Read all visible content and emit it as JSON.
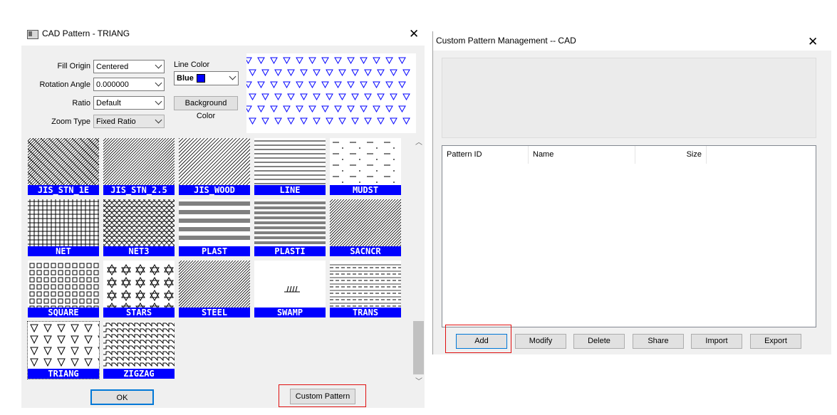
{
  "pattern_dialog": {
    "title": "CAD Pattern - TRIANG",
    "close": "✕",
    "fill_origin": {
      "label": "Fill Origin",
      "value": "Centered"
    },
    "rotation_angle": {
      "label": "Rotation Angle",
      "value": "0.000000"
    },
    "ratio": {
      "label": "Ratio",
      "value": "Default"
    },
    "zoom_type": {
      "label": "Zoom Type",
      "value": "Fixed Ratio"
    },
    "line_color": {
      "label": "Line Color",
      "value": "Blue",
      "color": "#0000ff"
    },
    "background_color_button": "Background Color",
    "patterns": [
      "JIS_STN_1E",
      "JIS_STN_2.5",
      "JIS_WOOD",
      "LINE",
      "MUDST",
      "NET",
      "NET3",
      "PLAST",
      "PLASTI",
      "SACNCR",
      "SQUARE",
      "STARS",
      "STEEL",
      "SWAMP",
      "TRANS",
      "TRIANG",
      "ZIGZAG"
    ],
    "selected_pattern": "TRIANG",
    "ok_button": "OK",
    "custom_pattern_button": "Custom Pattern"
  },
  "management_dialog": {
    "title": "Custom Pattern Management -- CAD",
    "close": "✕",
    "columns": [
      "Pattern ID",
      "Name",
      "Size"
    ],
    "rows": [],
    "buttons": {
      "add": "Add",
      "modify": "Modify",
      "delete": "Delete",
      "share": "Share",
      "import": "Import",
      "export": "Export"
    }
  },
  "colors": {
    "accent": "#0000ff",
    "highlight": "#e01010"
  }
}
